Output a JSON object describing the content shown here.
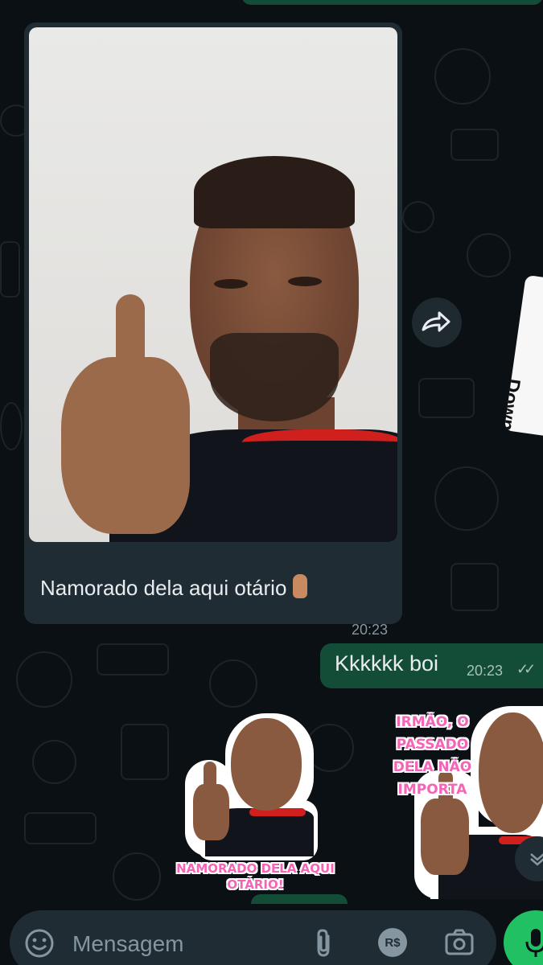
{
  "incoming_media": {
    "caption": "Namorado dela aqui otário",
    "time": "20:23"
  },
  "outgoing_message": {
    "text": "Kkkkkk boi",
    "time": "20:23",
    "status": "read-double-check"
  },
  "sticker_left": {
    "text_line1": "NAMORADO DELA AQUI",
    "text_line2": "OTÁRIO!"
  },
  "sticker_right": {
    "text_line1": "IRMÃO, O PASSADO",
    "text_line2": "DELA NÃO",
    "text_line3": "IMPORTA"
  },
  "download_tab_label": "Down",
  "composer": {
    "placeholder": "Mensagem",
    "pix_label": "R$"
  },
  "icons": [
    "forward-icon",
    "emoji-icon",
    "attach-icon",
    "pix-icon",
    "camera-icon",
    "mic-icon",
    "chevron-down-icon",
    "double-check-icon"
  ],
  "colors": {
    "background": "#0b1014",
    "incoming_bubble": "#1f2c34",
    "outgoing_bubble": "#144d37",
    "accent_green": "#21c063",
    "sticker_text": "#f564b7"
  }
}
